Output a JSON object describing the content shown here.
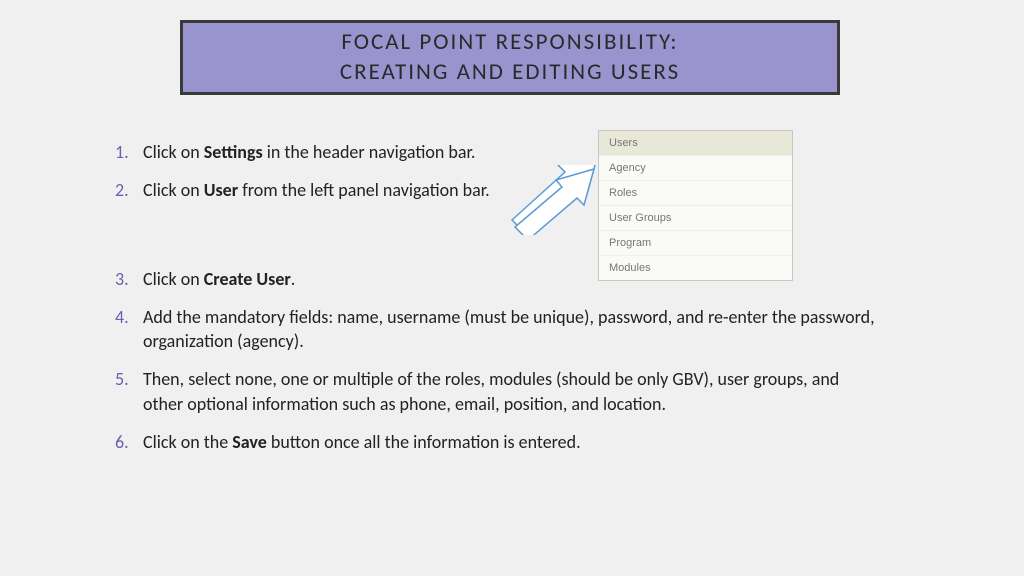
{
  "title": {
    "line1": "FOCAL POINT RESPONSIBILITY:",
    "line2": "CREATING AND EDITING USERS"
  },
  "steps": [
    {
      "num": "1.",
      "pre": "Click on ",
      "bold": "Settings",
      "post": " in the header navigation bar."
    },
    {
      "num": "2.",
      "pre": "Click on ",
      "bold": "User",
      "post": " from the left panel navigation bar."
    },
    {
      "num": "3.",
      "pre": "Click on ",
      "bold": "Create User",
      "post": "."
    },
    {
      "num": "4.",
      "pre": "Add the mandatory fields: name, username (must be unique), password, and re-enter the password, organization (agency).",
      "bold": "",
      "post": ""
    },
    {
      "num": "5.",
      "pre": "Then, select none, one or multiple of the roles, modules (should be only GBV), user groups, and other optional information such as phone, email, position, and location.",
      "bold": "",
      "post": ""
    },
    {
      "num": "6.",
      "pre": "Click on the ",
      "bold": "Save",
      "post": " button once all the information is entered."
    }
  ],
  "menu": {
    "items": [
      "Users",
      "Agency",
      "Roles",
      "User Groups",
      "Program",
      "Modules"
    ],
    "selected": 0
  }
}
